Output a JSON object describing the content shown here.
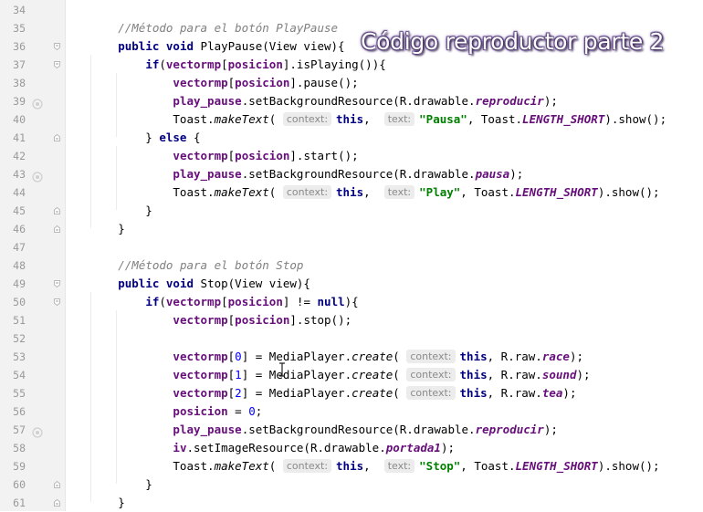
{
  "overlay_title": "Código reproductor parte 2",
  "colors": {
    "keyword": "#000080",
    "field": "#660e7a",
    "string": "#008000",
    "number": "#0000ff",
    "comment": "#808080",
    "gutter": "#f2f2f2"
  },
  "lines": [
    {
      "n": "34",
      "fold": "",
      "bp": false,
      "tokens": []
    },
    {
      "n": "35",
      "fold": "",
      "bp": false,
      "tokens": [
        {
          "t": "        "
        },
        {
          "t": "//Método para el botón PlayPause",
          "c": "cm"
        }
      ]
    },
    {
      "n": "36",
      "fold": "open",
      "bp": false,
      "tokens": [
        {
          "t": "        "
        },
        {
          "t": "public",
          "c": "kw"
        },
        {
          "t": " "
        },
        {
          "t": "void",
          "c": "kw"
        },
        {
          "t": " PlayPause(View view){"
        }
      ]
    },
    {
      "n": "37",
      "fold": "open",
      "bp": false,
      "tokens": [
        {
          "t": "            "
        },
        {
          "t": "if",
          "c": "kw"
        },
        {
          "t": "("
        },
        {
          "t": "vectormp",
          "c": "fld"
        },
        {
          "t": "["
        },
        {
          "t": "posicion",
          "c": "fld"
        },
        {
          "t": "].isPlaying()){"
        }
      ]
    },
    {
      "n": "38",
      "fold": "",
      "bp": false,
      "tokens": [
        {
          "t": "                "
        },
        {
          "t": "vectormp",
          "c": "fld"
        },
        {
          "t": "["
        },
        {
          "t": "posicion",
          "c": "fld"
        },
        {
          "t": "].pause();"
        }
      ]
    },
    {
      "n": "39",
      "fold": "",
      "bp": true,
      "tokens": [
        {
          "t": "                "
        },
        {
          "t": "play_pause",
          "c": "fld"
        },
        {
          "t": ".setBackgroundResource(R.drawable."
        },
        {
          "t": "reproducir",
          "c": "italfld"
        },
        {
          "t": ");"
        }
      ]
    },
    {
      "n": "40",
      "fold": "",
      "bp": false,
      "tokens": [
        {
          "t": "                Toast."
        },
        {
          "t": "makeText",
          "c": "ital"
        },
        {
          "t": "( "
        },
        {
          "h": "context:"
        },
        {
          "t": "this",
          "c": "kw"
        },
        {
          "t": ",  "
        },
        {
          "h": "text:"
        },
        {
          "t": "\"Pausa\"",
          "c": "str"
        },
        {
          "t": ", Toast."
        },
        {
          "t": "LENGTH_SHORT",
          "c": "italfld"
        },
        {
          "t": ").show();"
        }
      ]
    },
    {
      "n": "41",
      "fold": "close",
      "bp": false,
      "tokens": [
        {
          "t": "            } "
        },
        {
          "t": "else",
          "c": "kw"
        },
        {
          "t": " {"
        }
      ]
    },
    {
      "n": "42",
      "fold": "",
      "bp": false,
      "tokens": [
        {
          "t": "                "
        },
        {
          "t": "vectormp",
          "c": "fld"
        },
        {
          "t": "["
        },
        {
          "t": "posicion",
          "c": "fld"
        },
        {
          "t": "].start();"
        }
      ]
    },
    {
      "n": "43",
      "fold": "",
      "bp": true,
      "tokens": [
        {
          "t": "                "
        },
        {
          "t": "play_pause",
          "c": "fld"
        },
        {
          "t": ".setBackgroundResource(R.drawable."
        },
        {
          "t": "pausa",
          "c": "italfld"
        },
        {
          "t": ");"
        }
      ]
    },
    {
      "n": "44",
      "fold": "",
      "bp": false,
      "tokens": [
        {
          "t": "                Toast."
        },
        {
          "t": "makeText",
          "c": "ital"
        },
        {
          "t": "( "
        },
        {
          "h": "context:"
        },
        {
          "t": "this",
          "c": "kw"
        },
        {
          "t": ",  "
        },
        {
          "h": "text:"
        },
        {
          "t": "\"Play\"",
          "c": "str"
        },
        {
          "t": ", Toast."
        },
        {
          "t": "LENGTH_SHORT",
          "c": "italfld"
        },
        {
          "t": ").show();"
        }
      ]
    },
    {
      "n": "45",
      "fold": "close",
      "bp": false,
      "tokens": [
        {
          "t": "            }"
        }
      ]
    },
    {
      "n": "46",
      "fold": "close",
      "bp": false,
      "tokens": [
        {
          "t": "        }"
        }
      ]
    },
    {
      "n": "47",
      "fold": "",
      "bp": false,
      "tokens": []
    },
    {
      "n": "48",
      "fold": "",
      "bp": false,
      "tokens": [
        {
          "t": "        "
        },
        {
          "t": "//Método para el botón Stop",
          "c": "cm"
        }
      ]
    },
    {
      "n": "49",
      "fold": "open",
      "bp": false,
      "tokens": [
        {
          "t": "        "
        },
        {
          "t": "public",
          "c": "kw"
        },
        {
          "t": " "
        },
        {
          "t": "void",
          "c": "kw"
        },
        {
          "t": " Stop(View view){"
        }
      ]
    },
    {
      "n": "50",
      "fold": "open",
      "bp": false,
      "tokens": [
        {
          "t": "            "
        },
        {
          "t": "if",
          "c": "kw"
        },
        {
          "t": "("
        },
        {
          "t": "vectormp",
          "c": "fld"
        },
        {
          "t": "["
        },
        {
          "t": "posicion",
          "c": "fld"
        },
        {
          "t": "] != "
        },
        {
          "t": "null",
          "c": "kw"
        },
        {
          "t": "){"
        }
      ]
    },
    {
      "n": "51",
      "fold": "",
      "bp": false,
      "tokens": [
        {
          "t": "                "
        },
        {
          "t": "vectormp",
          "c": "fld"
        },
        {
          "t": "["
        },
        {
          "t": "posicion",
          "c": "fld"
        },
        {
          "t": "].stop();"
        }
      ]
    },
    {
      "n": "52",
      "fold": "",
      "bp": false,
      "tokens": []
    },
    {
      "n": "53",
      "fold": "",
      "bp": false,
      "tokens": [
        {
          "t": "                "
        },
        {
          "t": "vectormp",
          "c": "fld"
        },
        {
          "t": "["
        },
        {
          "t": "0",
          "c": "num"
        },
        {
          "t": "] = MediaPlayer."
        },
        {
          "t": "create",
          "c": "ital"
        },
        {
          "t": "( "
        },
        {
          "h": "context:"
        },
        {
          "t": "this",
          "c": "kw"
        },
        {
          "t": ", R.raw."
        },
        {
          "t": "race",
          "c": "italfld"
        },
        {
          "t": ");"
        }
      ]
    },
    {
      "n": "54",
      "fold": "",
      "bp": false,
      "tokens": [
        {
          "t": "                "
        },
        {
          "t": "vectormp",
          "c": "fld"
        },
        {
          "t": "["
        },
        {
          "t": "1",
          "c": "num"
        },
        {
          "t": "] = MediaPlayer."
        },
        {
          "t": "create",
          "c": "ital"
        },
        {
          "t": "( "
        },
        {
          "h": "context:"
        },
        {
          "t": "this",
          "c": "kw"
        },
        {
          "t": ", R.raw."
        },
        {
          "t": "sound",
          "c": "italfld"
        },
        {
          "t": ");"
        }
      ]
    },
    {
      "n": "55",
      "fold": "",
      "bp": false,
      "tokens": [
        {
          "t": "                "
        },
        {
          "t": "vectormp",
          "c": "fld"
        },
        {
          "t": "["
        },
        {
          "t": "2",
          "c": "num"
        },
        {
          "t": "] = MediaPlayer."
        },
        {
          "t": "create",
          "c": "ital"
        },
        {
          "t": "( "
        },
        {
          "h": "context:"
        },
        {
          "t": "this",
          "c": "kw"
        },
        {
          "t": ", R.raw."
        },
        {
          "t": "tea",
          "c": "italfld"
        },
        {
          "t": ");"
        }
      ]
    },
    {
      "n": "56",
      "fold": "",
      "bp": false,
      "tokens": [
        {
          "t": "                "
        },
        {
          "t": "posicion",
          "c": "fld"
        },
        {
          "t": " = "
        },
        {
          "t": "0",
          "c": "num"
        },
        {
          "t": ";"
        }
      ]
    },
    {
      "n": "57",
      "fold": "",
      "bp": true,
      "tokens": [
        {
          "t": "                "
        },
        {
          "t": "play_pause",
          "c": "fld"
        },
        {
          "t": ".setBackgroundResource(R.drawable."
        },
        {
          "t": "reproducir",
          "c": "italfld"
        },
        {
          "t": ");"
        }
      ]
    },
    {
      "n": "58",
      "fold": "",
      "bp": false,
      "tokens": [
        {
          "t": "                "
        },
        {
          "t": "iv",
          "c": "fld"
        },
        {
          "t": ".setImageResource(R.drawable."
        },
        {
          "t": "portada1",
          "c": "italfld"
        },
        {
          "t": ");"
        }
      ]
    },
    {
      "n": "59",
      "fold": "",
      "bp": false,
      "tokens": [
        {
          "t": "                Toast."
        },
        {
          "t": "makeText",
          "c": "ital"
        },
        {
          "t": "( "
        },
        {
          "h": "context:"
        },
        {
          "t": "this",
          "c": "kw"
        },
        {
          "t": ",  "
        },
        {
          "h": "text:"
        },
        {
          "t": "\"Stop\"",
          "c": "str"
        },
        {
          "t": ", Toast."
        },
        {
          "t": "LENGTH_SHORT",
          "c": "italfld"
        },
        {
          "t": ").show();"
        }
      ]
    },
    {
      "n": "60",
      "fold": "close",
      "bp": false,
      "tokens": [
        {
          "t": "            }"
        }
      ]
    },
    {
      "n": "61",
      "fold": "close",
      "bp": false,
      "tokens": [
        {
          "t": "        }"
        }
      ]
    }
  ]
}
